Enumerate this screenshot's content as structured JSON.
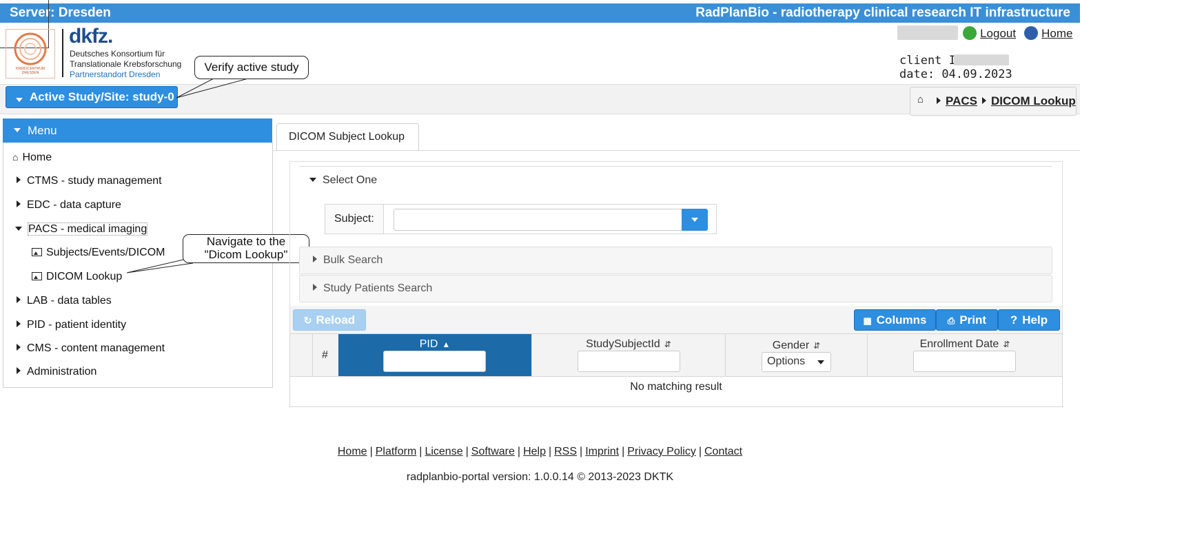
{
  "header": {
    "server": "Server: Dresden",
    "app_title": "RadPlanBio - radiotherapy clinical research IT infrastructure"
  },
  "logo": {
    "brand": "dkfz.",
    "line1": "Deutsches Konsortium für",
    "line2": "Translationale Krebsforschung",
    "line3": "Partnerstandort Dresden",
    "seal_text": "KREBSCENTRUM DRESDEN"
  },
  "user": {
    "logout": "Logout",
    "home": "Home",
    "client_ip_label": "client IP:",
    "date": "date: 04.09.2023"
  },
  "study": {
    "label": "Active Study/Site: study-0"
  },
  "breadcrumb": [
    "PACS",
    "DICOM Lookup"
  ],
  "callouts": {
    "verify": "Verify active study",
    "navigate_1": "Navigate to the",
    "navigate_2": "\"Dicom Lookup\""
  },
  "menu": {
    "title": "Menu",
    "items": [
      {
        "label": "Home"
      },
      {
        "label": "CTMS - study management"
      },
      {
        "label": "EDC - data capture"
      },
      {
        "label": "PACS - medical imaging"
      },
      {
        "label": "Subjects/Events/DICOM"
      },
      {
        "label": "DICOM Lookup"
      },
      {
        "label": "LAB - data tables"
      },
      {
        "label": "PID - patient identity"
      },
      {
        "label": "CMS - content management"
      },
      {
        "label": "Administration"
      }
    ]
  },
  "tab": {
    "label": "DICOM Subject Lookup"
  },
  "lookup": {
    "select_one": "Select One",
    "subject_label": "Subject:",
    "subject_value": "",
    "bulk_search": "Bulk Search",
    "study_patients_search": "Study Patients Search"
  },
  "toolbar": {
    "reload": "Reload",
    "columns": "Columns",
    "print": "Print",
    "help": "Help"
  },
  "table": {
    "columns": [
      "#",
      "PID",
      "StudySubjectId",
      "Gender",
      "Enrollment Date"
    ],
    "gender_filter": "Options",
    "empty_message": "No matching result"
  },
  "footer": {
    "links": [
      "Home",
      "Platform",
      "License",
      "Software",
      "Help",
      "RSS",
      "Imprint",
      "Privacy Policy",
      "Contact"
    ],
    "version": "radplanbio-portal version: 1.0.0.14 © 2013-2023 DKTK"
  },
  "colors": {
    "accent": "#2e8ee0",
    "topbar": "#3b8fd6",
    "sorted_header": "#1c6aa8"
  }
}
